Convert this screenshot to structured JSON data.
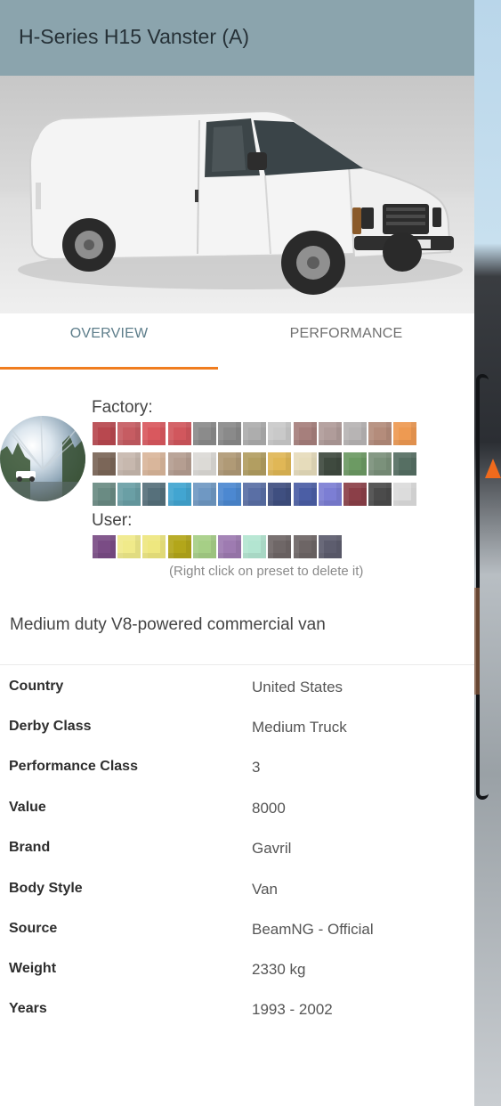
{
  "header": {
    "title": "H-Series H15 Vanster (A)"
  },
  "tabs": [
    {
      "label": "OVERVIEW",
      "active": true
    },
    {
      "label": "PERFORMANCE",
      "active": false
    }
  ],
  "colors": {
    "header_bg": "#8ba4ad",
    "accent": "#f07d1f",
    "active_tab_text": "#5d7d8a",
    "factory_presets": [
      "#b8484f",
      "#c65c62",
      "#d9585e",
      "#d1575d",
      "#8b8b8b",
      "#8a8a8a",
      "#adadad",
      "#c9c9c9",
      "#a67f7c",
      "#b09c9a",
      "#b7b4b4",
      "#b48c7b",
      "#ee9a52",
      "#7b6658",
      "#c7b8ae",
      "#d9b69b",
      "#b59e91",
      "#dcdad6",
      "#b09a76",
      "#b29e61",
      "#e0b756",
      "#e6dcbb",
      "#3f4a3f",
      "#6c9a63",
      "#7b917b",
      "#566f63",
      "#6a8b83",
      "#6a9fa5",
      "#56707b",
      "#42a5d1",
      "#6f98c3",
      "#4c88d1",
      "#5a6fa5",
      "#3f4f80",
      "#4b5ea5",
      "#7c7ed4",
      "#8b3f48",
      "#4b4b4b",
      "#dcdcdc"
    ],
    "user_presets": [
      "#7a4c85",
      "#f0ea8a",
      "#eee77f",
      "#b3a61a",
      "#a6cf86",
      "#9e7bb1",
      "#b3e5d1",
      "#6f6767",
      "#6d6565",
      "#5d5d6e"
    ]
  },
  "paint": {
    "factory_label": "Factory:",
    "user_label": "User:",
    "hint": "(Right click on preset to delete it)"
  },
  "description": "Medium duty V8-powered commercial van",
  "info": [
    {
      "key": "Country",
      "value": "United States"
    },
    {
      "key": "Derby Class",
      "value": "Medium Truck"
    },
    {
      "key": "Performance Class",
      "value": "3"
    },
    {
      "key": "Value",
      "value": "8000"
    },
    {
      "key": "Brand",
      "value": "Gavril"
    },
    {
      "key": "Body Style",
      "value": "Van"
    },
    {
      "key": "Source",
      "value": "BeamNG - Official"
    },
    {
      "key": "Weight",
      "value": "2330 kg"
    },
    {
      "key": "Years",
      "value": "1993 - 2002"
    }
  ]
}
